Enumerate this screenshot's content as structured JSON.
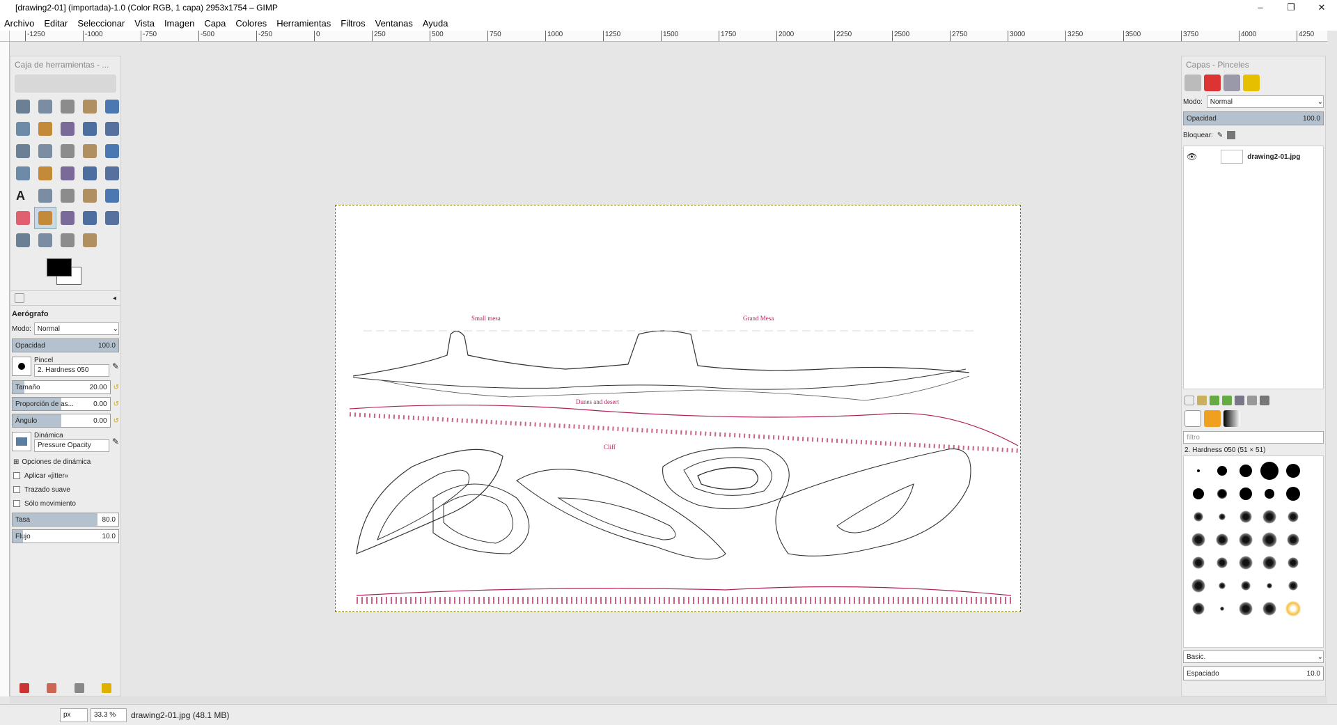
{
  "window": {
    "title": "[drawing2-01] (importada)-1.0 (Color RGB, 1 capa) 2953x1754 – GIMP",
    "controls": [
      "–",
      "❐",
      "✕"
    ]
  },
  "menu": [
    "Archivo",
    "Editar",
    "Seleccionar",
    "Vista",
    "Imagen",
    "Capa",
    "Colores",
    "Herramientas",
    "Filtros",
    "Ventanas",
    "Ayuda"
  ],
  "ruler_labels": [
    "-1250",
    "-1000",
    "-750",
    "-500",
    "-250",
    "0",
    "250",
    "500",
    "750",
    "1000",
    "1250",
    "1500",
    "1750",
    "2000",
    "2250",
    "2500",
    "2750",
    "3000",
    "3250",
    "3500",
    "3750",
    "4000",
    "4250"
  ],
  "toolbox": {
    "title": "Caja de herramientas - ...",
    "tool_options_title": "Aerógrafo",
    "mode_label": "Modo:",
    "mode_value": "Normal",
    "opacity_label": "Opacidad",
    "opacity_value": "100.0",
    "opacity_fraction": 1.0,
    "brush_label": "Pincel",
    "brush_value": "2. Hardness 050",
    "size_label": "Tamaño",
    "size_value": "20.00",
    "size_fraction": 0.12,
    "aspect_label": "Proporción de as...",
    "aspect_value": "0.00",
    "aspect_fraction": 0.5,
    "angle_label": "Ángulo",
    "angle_value": "0.00",
    "angle_fraction": 0.5,
    "dynamics_label": "Dinámica",
    "dynamics_value": "Pressure Opacity",
    "dynamics_options": "Opciones de dinámica",
    "jitter": "Aplicar «jitter»",
    "smooth": "Trazado suave",
    "motion_only": "Sólo movimiento",
    "rate_label": "Tasa",
    "rate_value": "80.0",
    "rate_fraction": 0.8,
    "flow_label": "Flujo",
    "flow_value": "10.0",
    "flow_fraction": 0.1
  },
  "tools": [
    "rect-select",
    "ellipse-select",
    "free-select",
    "fuzzy-select",
    "by-color-select",
    "scissors-select",
    "foreground-select",
    "paths",
    "color-picker",
    "zoom",
    "measure",
    "move",
    "align",
    "crop",
    "rotate",
    "scale",
    "shear",
    "perspective",
    "flip",
    "cage-transform",
    "text",
    "bucket-fill",
    "gradient",
    "pencil",
    "paintbrush",
    "eraser",
    "airbrush",
    "ink",
    "clone",
    "heal",
    "perspective-clone",
    "blur",
    "smudge",
    "dodge-burn"
  ],
  "layers_dock": {
    "title": "Capas - Pinceles",
    "mode_label": "Modo:",
    "mode_value": "Normal",
    "opacity_label": "Opacidad",
    "opacity_value": "100.0",
    "lock_label": "Bloquear:",
    "layer_name": "drawing2-01.jpg",
    "filter_placeholder": "filtro",
    "brush_info": "2. Hardness 050 (51 × 51)",
    "brush_tag": "Basic.",
    "spacing_label": "Espaciado",
    "spacing_value": "10.0"
  },
  "drawing_labels": {
    "label1": "Small mesa",
    "label2": "Grand Mesa",
    "label3": "Dunes and desert",
    "label4": "Cliff"
  },
  "status": {
    "unit": "px",
    "zoom": "33.3 %",
    "file_info": "drawing2-01.jpg (48.1 MB)"
  },
  "colors": {
    "accent_magenta": "#b0205a",
    "slider_fill": "#b4c2cf",
    "selection_border": "#7a7a00"
  }
}
